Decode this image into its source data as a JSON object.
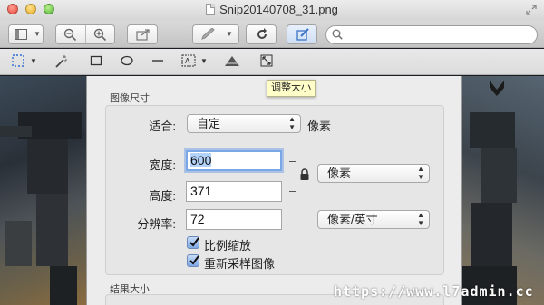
{
  "window": {
    "title": "Snip20140708_31.png"
  },
  "toolbar": {
    "zoom_out_symbol": "−",
    "zoom_in_symbol": "+",
    "search_placeholder": ""
  },
  "tooltip": {
    "text": "调整大小"
  },
  "image_size": {
    "section_label": "图像尺寸",
    "fit_label": "适合:",
    "fit_value": "自定",
    "fit_unit": "像素",
    "width_label": "宽度:",
    "width_value": "600",
    "height_label": "高度:",
    "height_value": "371",
    "size_unit": "像素",
    "resolution_label": "分辨率:",
    "resolution_value": "72",
    "resolution_unit": "像素/英寸",
    "scale_proportionally_label": "比例缩放",
    "scale_proportionally_checked": true,
    "resample_label": "重新采样图像",
    "resample_checked": true
  },
  "result_size": {
    "section_label": "结果大小"
  },
  "watermark": {
    "text": "https://www.l7admin.cc"
  },
  "colors": {
    "focus_ring": "#7aa7e6",
    "checkbox_fill": "#7ea8e6",
    "tooltip_bg": "#fffec8"
  }
}
